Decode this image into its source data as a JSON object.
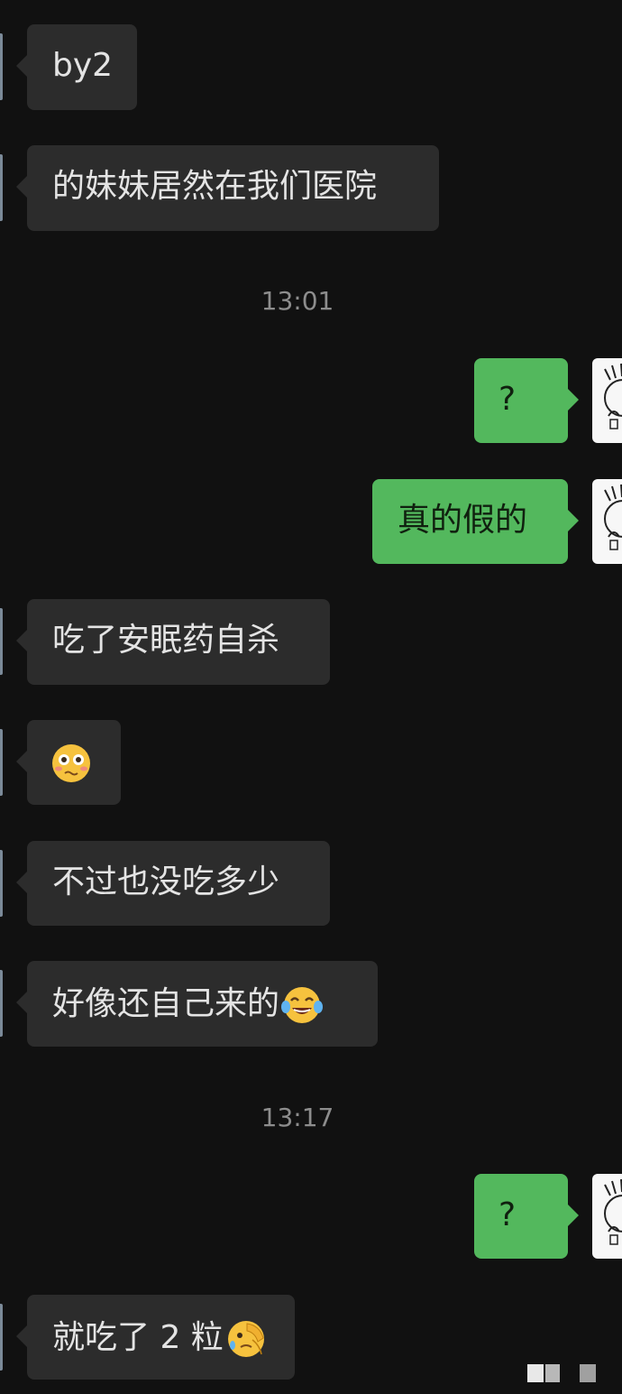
{
  "messages": [
    {
      "side": "in",
      "text": "by2"
    },
    {
      "side": "in",
      "text": "的妹妹居然在我们医院"
    },
    {
      "timestamp": "13:01"
    },
    {
      "side": "out",
      "text": "?"
    },
    {
      "side": "out",
      "text": "真的假的"
    },
    {
      "side": "in",
      "text": "吃了安眠药自杀"
    },
    {
      "side": "in",
      "emoji": "flushed-face-icon"
    },
    {
      "side": "in",
      "text": "不过也没吃多少"
    },
    {
      "side": "in",
      "text": "好像还自己来的",
      "emoji": "tears-of-joy-icon"
    },
    {
      "timestamp": "13:17"
    },
    {
      "side": "out",
      "text": "?"
    },
    {
      "side": "in",
      "text": "就吃了 2 粒",
      "emoji": "face-palm-icon"
    }
  ],
  "colors": {
    "background": "#111111",
    "incoming_bubble": "#2c2c2c",
    "outgoing_bubble": "#53b85d",
    "timestamp_text": "#8d8d8d"
  }
}
